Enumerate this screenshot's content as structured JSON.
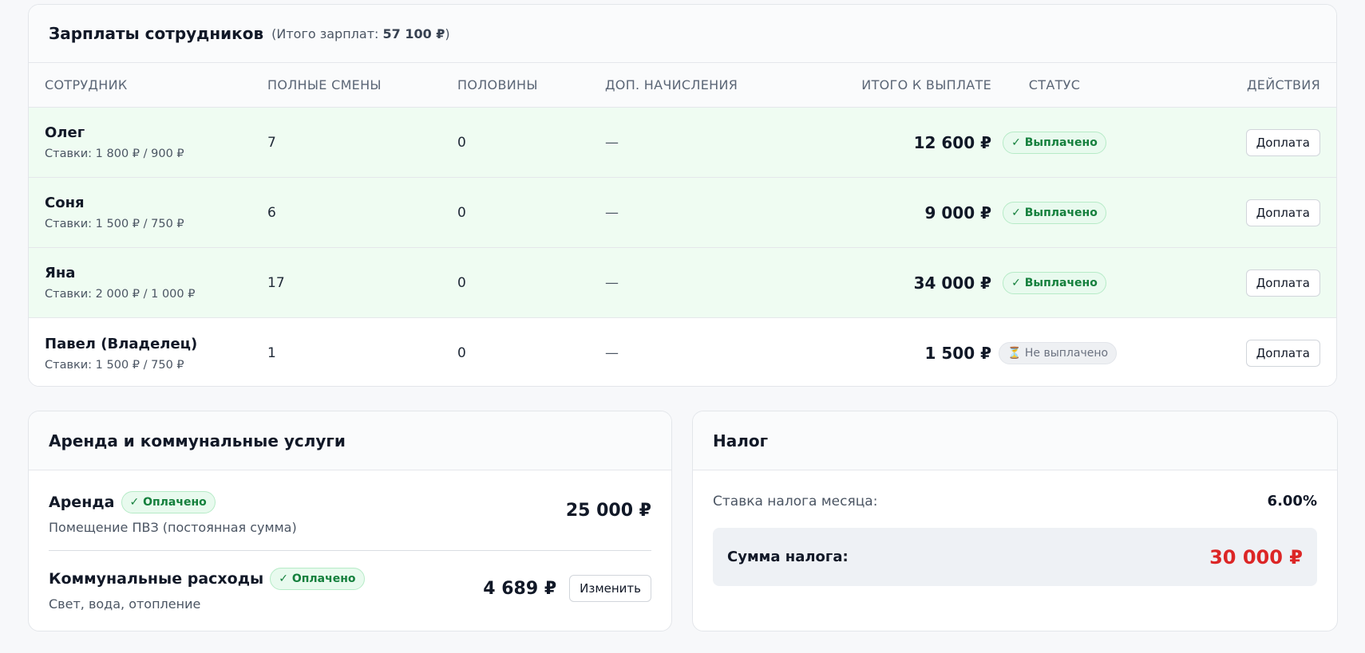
{
  "salaries": {
    "title": "Зарплаты сотрудников",
    "summary_prefix": "(Итого зарплат: ",
    "summary_total": "57 100 ₽",
    "summary_suffix": ")",
    "columns": {
      "employee": "СОТРУДНИК",
      "full_shifts": "ПОЛНЫЕ СМЕНЫ",
      "halves": "ПОЛОВИНЫ",
      "extra": "ДОП. НАЧИСЛЕНИЯ",
      "total": "ИТОГО К ВЫПЛАТЕ",
      "status": "СТАТУС",
      "actions": "ДЕЙСТВИЯ"
    },
    "rows": [
      {
        "name": "Олег",
        "rates": "Ставки: 1 800 ₽ / 900 ₽",
        "full": "7",
        "halves": "0",
        "extra": "—",
        "total": "12 600 ₽",
        "status": "✓ Выплачено",
        "paid": true,
        "action": "Доплата"
      },
      {
        "name": "Соня",
        "rates": "Ставки: 1 500 ₽ / 750 ₽",
        "full": "6",
        "halves": "0",
        "extra": "—",
        "total": "9 000 ₽",
        "status": "✓ Выплачено",
        "paid": true,
        "action": "Доплата"
      },
      {
        "name": "Яна",
        "rates": "Ставки: 2 000 ₽ / 1 000 ₽",
        "full": "17",
        "halves": "0",
        "extra": "—",
        "total": "34 000 ₽",
        "status": "✓ Выплачено",
        "paid": true,
        "action": "Доплата"
      },
      {
        "name": "Павел (Владелец)",
        "rates": "Ставки: 1 500 ₽ / 750 ₽",
        "full": "1",
        "halves": "0",
        "extra": "—",
        "total": "1 500 ₽",
        "status": "⏳ Не выплачено",
        "paid": false,
        "action": "Доплата"
      }
    ]
  },
  "rent": {
    "title": "Аренда и коммунальные услуги",
    "items": [
      {
        "name": "Аренда",
        "badge": "✓ Оплачено",
        "desc": "Помещение ПВЗ (постоянная сумма)",
        "amount": "25 000 ₽"
      },
      {
        "name": "Коммунальные расходы",
        "badge": "✓ Оплачено",
        "desc": "Свет, вода, отопление",
        "amount": "4 689 ₽",
        "action": "Изменить"
      }
    ]
  },
  "tax": {
    "title": "Налог",
    "rate_label": "Ставка налога месяца:",
    "rate_value": "6.00%",
    "sum_label": "Сумма налога:",
    "sum_value": "30 000 ₽"
  },
  "colors": {
    "paid_row_bg": "#effcf2",
    "paid_badge_text": "#15803d",
    "tax_sum": "#dc2626"
  }
}
